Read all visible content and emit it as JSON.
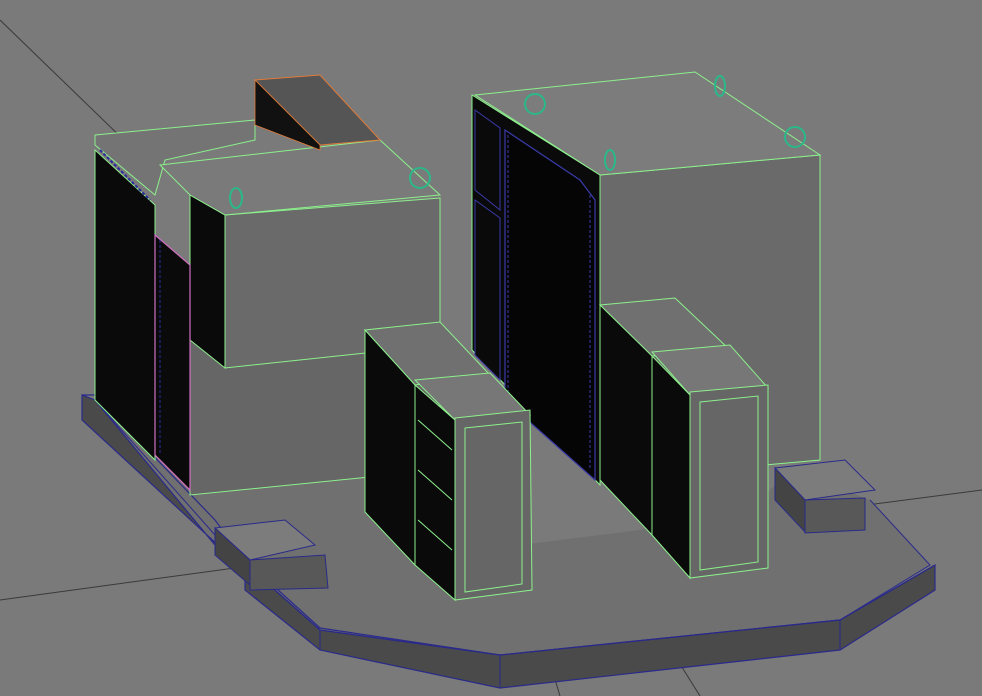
{
  "viewport": {
    "background": "#7a7a7a",
    "wire_selected": "#8cf08c",
    "wire_base": "#2a2a8a",
    "wire_accent": "#e07a3a",
    "wire_pink": "#d070c0",
    "wire_teal": "#2ab88a",
    "face_dark": "#0a0a0a",
    "face_mid": "#5e5e5e",
    "face_light": "#6c6c6c",
    "face_top": "#7c7c7c"
  }
}
